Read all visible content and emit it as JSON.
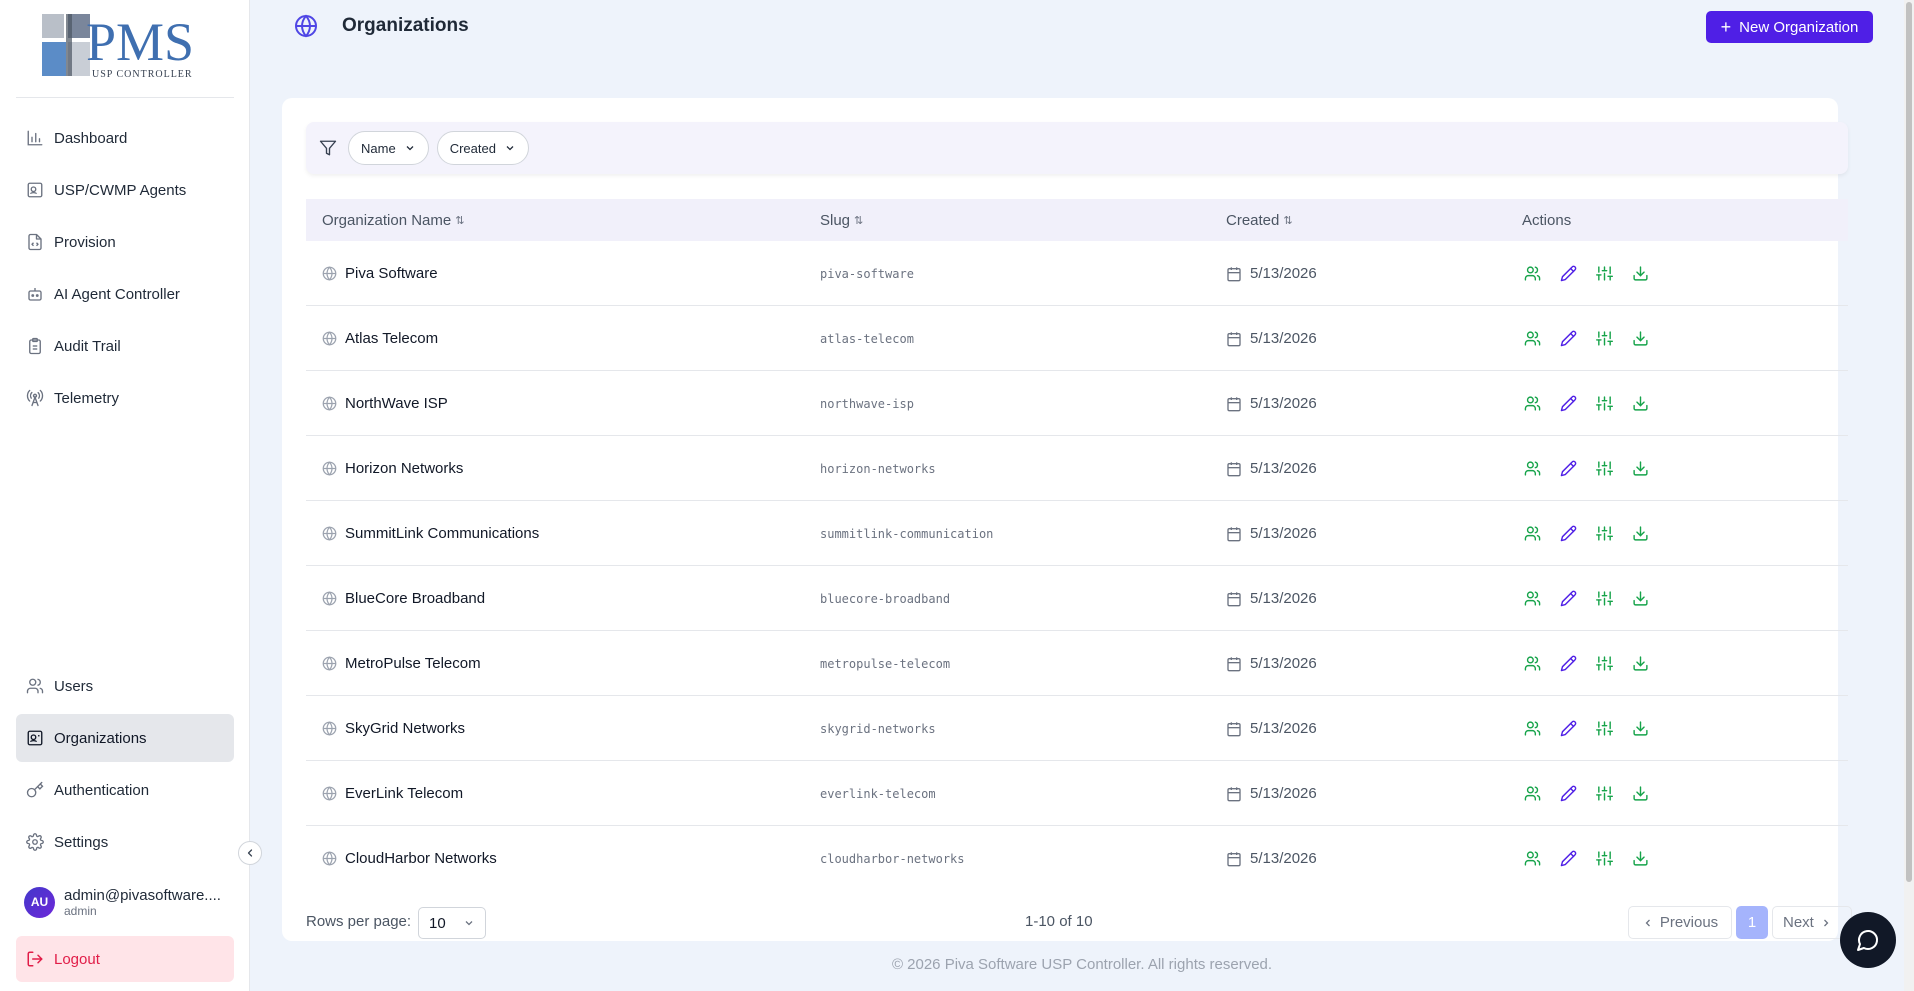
{
  "app": {
    "logo_text": "PMS",
    "logo_subtext": "USP CONTROLLER"
  },
  "sidebar": {
    "items": [
      {
        "label": "Dashboard",
        "icon": "bar-chart-icon"
      },
      {
        "label": "USP/CWMP Agents",
        "icon": "agent-icon"
      },
      {
        "label": "Provision",
        "icon": "file-code-icon"
      },
      {
        "label": "AI Agent Controller",
        "icon": "bot-icon"
      },
      {
        "label": "Audit Trail",
        "icon": "clipboard-icon"
      },
      {
        "label": "Telemetry",
        "icon": "radio-tower-icon"
      }
    ],
    "bottom_items": [
      {
        "label": "Users",
        "icon": "users-icon"
      },
      {
        "label": "Organizations",
        "icon": "organization-icon",
        "active": true
      },
      {
        "label": "Authentication",
        "icon": "key-icon"
      },
      {
        "label": "Settings",
        "icon": "gear-icon"
      }
    ],
    "user": {
      "initials": "AU",
      "email": "admin@pivasoftware....",
      "role": "admin"
    },
    "logout_label": "Logout"
  },
  "header": {
    "title": "Organizations",
    "new_button_label": "New Organization"
  },
  "filters": {
    "chips": [
      "Name",
      "Created"
    ]
  },
  "table": {
    "columns": [
      "Organization Name",
      "Slug",
      "Created",
      "Actions"
    ],
    "rows": [
      {
        "name": "Piva Software",
        "slug": "piva-software",
        "created": "5/13/2026"
      },
      {
        "name": "Atlas Telecom",
        "slug": "atlas-telecom",
        "created": "5/13/2026"
      },
      {
        "name": "NorthWave ISP",
        "slug": "northwave-isp",
        "created": "5/13/2026"
      },
      {
        "name": "Horizon Networks",
        "slug": "horizon-networks",
        "created": "5/13/2026"
      },
      {
        "name": "SummitLink Communications",
        "slug": "summitlink-communication",
        "created": "5/13/2026"
      },
      {
        "name": "BlueCore Broadband",
        "slug": "bluecore-broadband",
        "created": "5/13/2026"
      },
      {
        "name": "MetroPulse Telecom",
        "slug": "metropulse-telecom",
        "created": "5/13/2026"
      },
      {
        "name": "SkyGrid Networks",
        "slug": "skygrid-networks",
        "created": "5/13/2026"
      },
      {
        "name": "EverLink Telecom",
        "slug": "everlink-telecom",
        "created": "5/13/2026"
      },
      {
        "name": "CloudHarbor Networks",
        "slug": "cloudharbor-networks",
        "created": "5/13/2026"
      }
    ]
  },
  "pagination": {
    "rows_per_page_label": "Rows per page:",
    "rows_per_page": "10",
    "range_text": "1-10 of 10",
    "previous_label": "Previous",
    "current_page": "1",
    "next_label": "Next"
  },
  "footer": {
    "copyright": "© 2026 Piva Software USP Controller. All rights reserved."
  },
  "colors": {
    "accent": "#4f1fe6",
    "action_green": "#16a34a",
    "action_purple": "#4f1fe6"
  }
}
